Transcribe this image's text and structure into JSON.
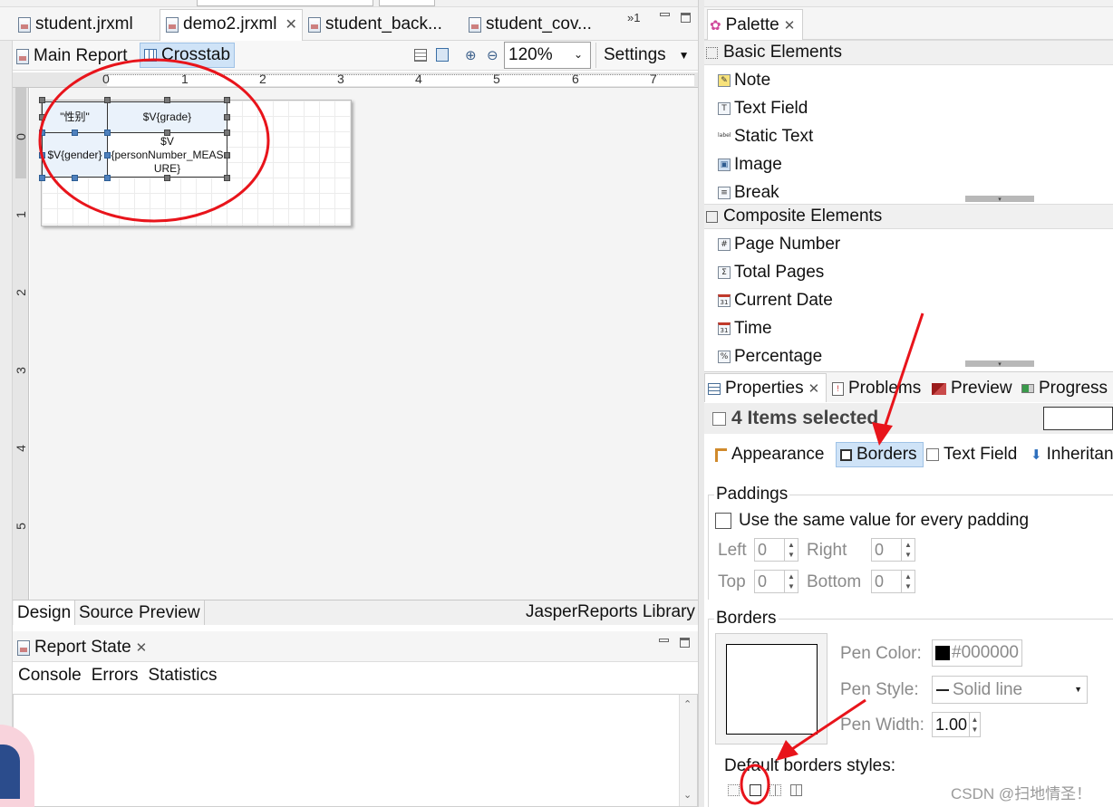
{
  "editor_tabs": [
    "student.jrxml",
    "demo2.jrxml",
    "student_back...",
    "student_cov..."
  ],
  "editor_tabs_overflow": "»1",
  "report_bar": {
    "main_report": "Main Report",
    "crosstab": "Crosstab",
    "zoom": "120%",
    "settings": "Settings"
  },
  "ruler": {
    "h_ticks": [
      "0",
      "1",
      "2",
      "3",
      "4",
      "5",
      "6",
      "7"
    ],
    "v_ticks": [
      "0",
      "1",
      "2",
      "3",
      "4",
      "5"
    ]
  },
  "crosstab": {
    "corner": "\"性别\"",
    "col_header": "$V{grade}",
    "row_header": "$V{gender}",
    "measure": "$V\n{personNumber_MEAS\nURE}"
  },
  "editor_bottom_tabs": {
    "design": "Design",
    "source": "Source",
    "preview": "Preview",
    "library": "JasperReports Library"
  },
  "report_state": {
    "title": "Report State",
    "tabs": [
      "Console",
      "Errors",
      "Statistics"
    ]
  },
  "palette": {
    "title": "Palette",
    "basic_title": "Basic Elements",
    "basic": [
      {
        "label": "Note",
        "icon": "note-icon",
        "glyph": "✎"
      },
      {
        "label": "Text Field",
        "icon": "text-field-icon",
        "glyph": "T"
      },
      {
        "label": "Static Text",
        "icon": "static-text-icon",
        "glyph": "label"
      },
      {
        "label": "Image",
        "icon": "image-icon",
        "glyph": "▣"
      },
      {
        "label": "Break",
        "icon": "break-icon",
        "glyph": "≡"
      }
    ],
    "composite_title": "Composite Elements",
    "composite": [
      {
        "label": "Page Number",
        "icon": "page-number-icon",
        "glyph": "#"
      },
      {
        "label": "Total Pages",
        "icon": "total-pages-icon",
        "glyph": "Σ"
      },
      {
        "label": "Current Date",
        "icon": "calendar-icon",
        "glyph": "31"
      },
      {
        "label": "Time",
        "icon": "time-icon",
        "glyph": "31"
      },
      {
        "label": "Percentage",
        "icon": "percentage-icon",
        "glyph": "%"
      }
    ]
  },
  "views": [
    "Properties",
    "Problems",
    "Preview",
    "Progress"
  ],
  "selection_title": "4 Items selected",
  "prop_tabs": [
    "Appearance",
    "Borders",
    "Text Field",
    "Inheritan"
  ],
  "paddings": {
    "title": "Paddings",
    "same_value": "Use the same value for every padding",
    "left_label": "Left",
    "left": "0",
    "right_label": "Right",
    "right": "0",
    "top_label": "Top",
    "top": "0",
    "bottom_label": "Bottom",
    "bottom": "0"
  },
  "borders": {
    "title": "Borders",
    "pen_color_label": "Pen Color:",
    "pen_color": "#000000",
    "pen_style_label": "Pen Style:",
    "pen_style": "Solid line",
    "pen_width_label": "Pen Width:",
    "pen_width": "1.00",
    "default_styles": "Default borders styles:"
  },
  "watermark": "CSDN @扫地情圣！",
  "colors": {
    "annotation_red": "#e8141b",
    "selected_tab": "#cfe3f7"
  }
}
